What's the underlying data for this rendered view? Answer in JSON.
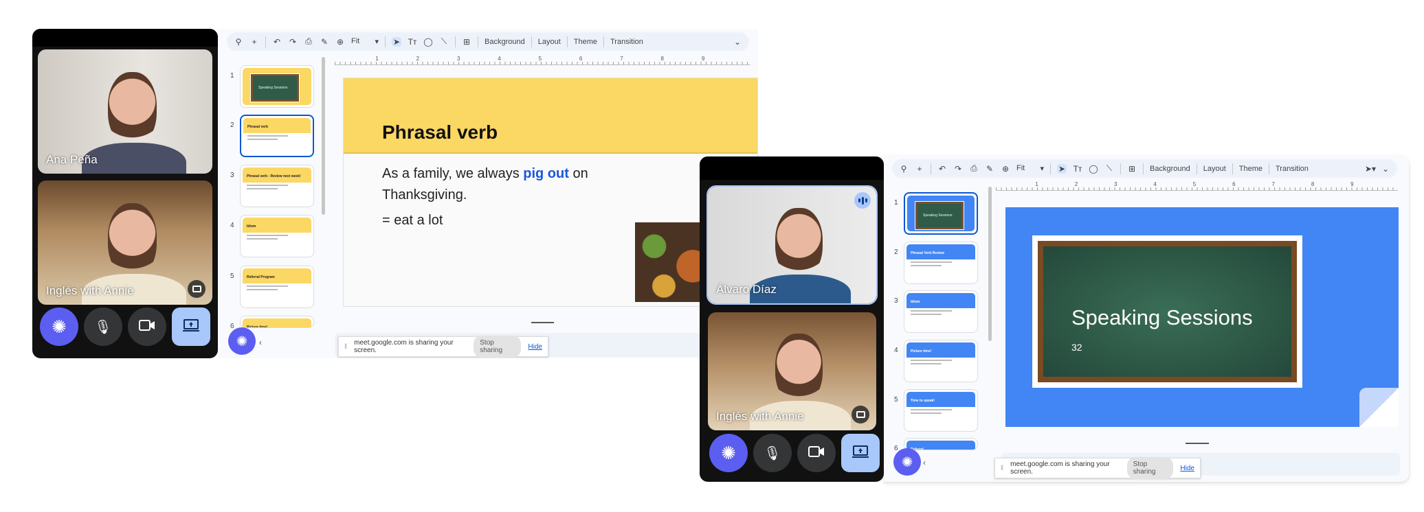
{
  "left": {
    "participants": [
      {
        "name": "Ana Peña"
      },
      {
        "name": "Inglés with Annie"
      }
    ],
    "slides": {
      "thumbnails": [
        {
          "num": "1",
          "title": "Speaking Sessions"
        },
        {
          "num": "2",
          "title": "Phrasal verb"
        },
        {
          "num": "3",
          "title": "Phrasal verb - Review next week!"
        },
        {
          "num": "4",
          "title": "Idiom"
        },
        {
          "num": "5",
          "title": "Referral Program"
        },
        {
          "num": "6",
          "title": "Picture time!"
        }
      ],
      "current": {
        "title": "Phrasal verb",
        "body_before": "As a family, we always ",
        "body_highlight": "pig out",
        "body_after": " on Thanksgiving.",
        "definition": "= eat a lot"
      }
    }
  },
  "right": {
    "participants": [
      {
        "name": "Álvaro Díaz"
      },
      {
        "name": "Inglés with Annie"
      }
    ],
    "slides": {
      "thumbnails": [
        {
          "num": "1",
          "title": "Speaking Sessions"
        },
        {
          "num": "2",
          "title": "Phrasal Verb Review"
        },
        {
          "num": "3",
          "title": "Idiom"
        },
        {
          "num": "4",
          "title": "Picture time!"
        },
        {
          "num": "5",
          "title": "Time to speak!"
        },
        {
          "num": "6",
          "title": "Referral"
        }
      ],
      "current": {
        "title": "Speaking Sessions",
        "subtitle": "32"
      }
    }
  },
  "toolbar": {
    "zoom_value": "Fit",
    "background": "Background",
    "layout": "Layout",
    "theme": "Theme",
    "transition": "Transition"
  },
  "ruler": [
    "1",
    "2",
    "3",
    "4",
    "5",
    "6",
    "7",
    "8",
    "9"
  ],
  "sharing": {
    "message": "meet.google.com is sharing your screen.",
    "stop": "Stop sharing",
    "hide": "Hide"
  },
  "colors": {
    "yellow": "#fbd764",
    "blue": "#4285f4",
    "accent": "#5b5ef0",
    "share_btn": "#a8c7fa"
  }
}
